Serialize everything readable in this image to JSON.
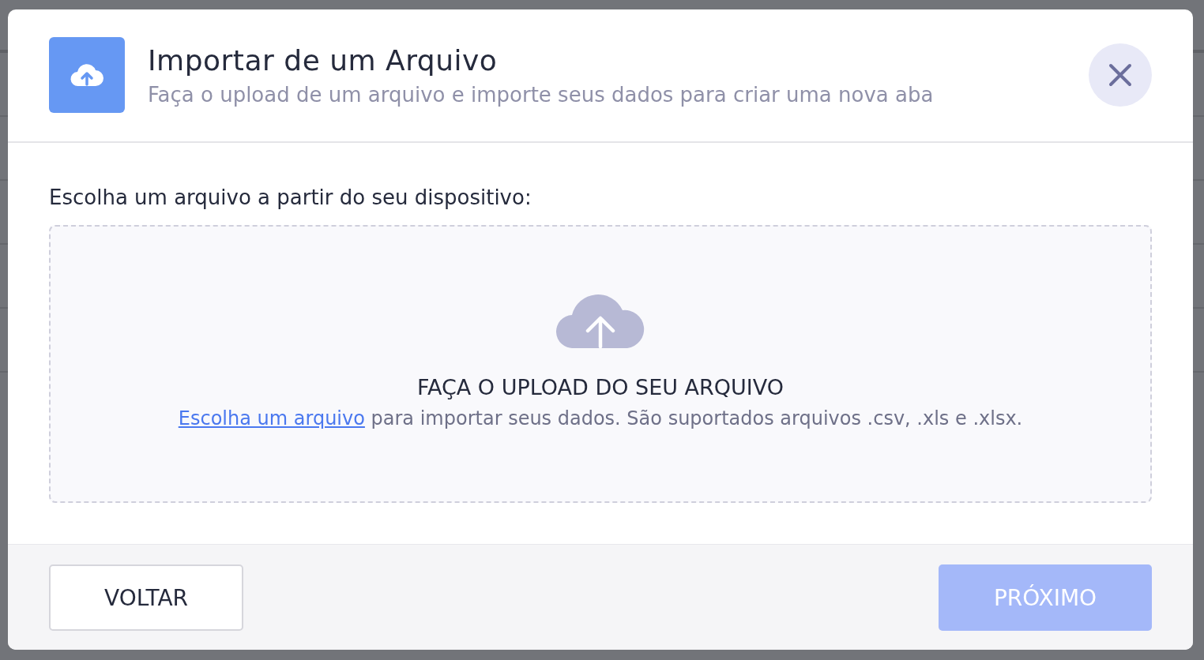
{
  "dialog": {
    "title": "Importar de um Arquivo",
    "subtitle": "Faça o upload de um arquivo e importe seus dados para criar uma nova aba"
  },
  "body": {
    "label": "Escolha um arquivo a partir do seu dispositivo:",
    "dropzone": {
      "heading": "FAÇA O UPLOAD DO SEU ARQUIVO",
      "link": "Escolha um arquivo",
      "text": "para importar seus dados. São suportados arquivos .csv, .xls e .xlsx."
    }
  },
  "footer": {
    "buttons": [
      {
        "label": "VOLTAR",
        "kind": "secondary",
        "disabled": false
      },
      {
        "label": "PRÓXIMO",
        "kind": "primary",
        "disabled": true
      }
    ]
  }
}
